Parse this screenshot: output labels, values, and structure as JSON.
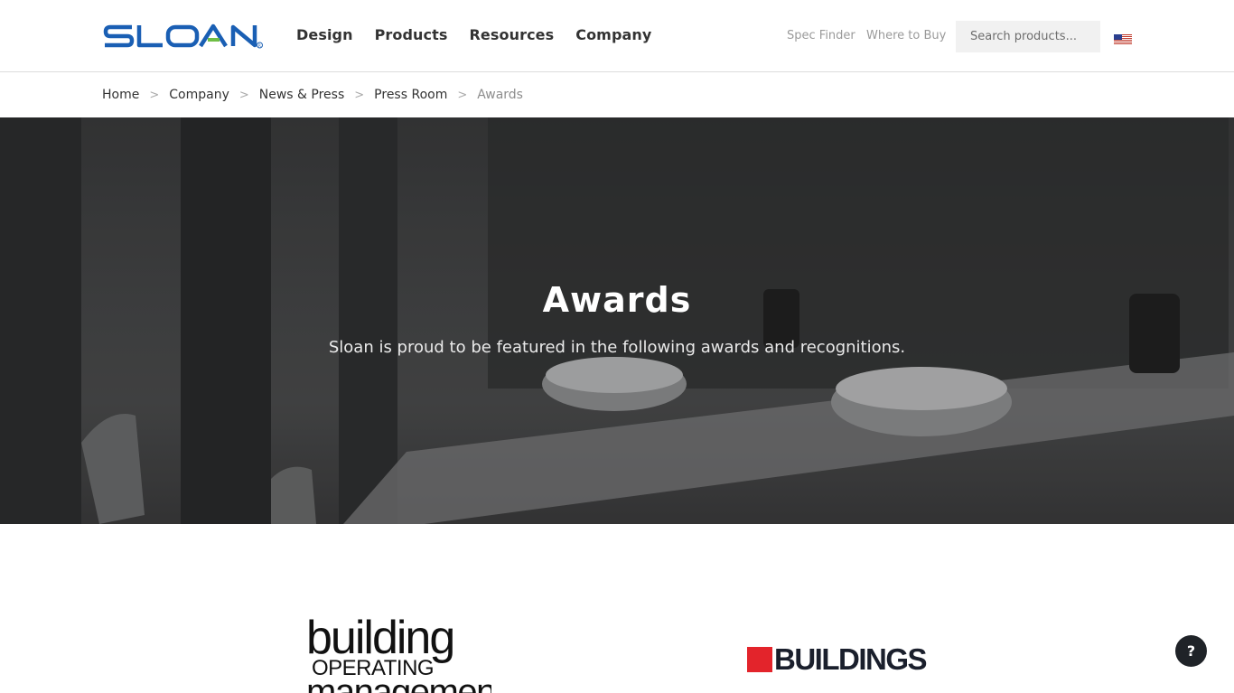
{
  "header": {
    "logo_text": "SLOAN",
    "nav": [
      "Design",
      "Products",
      "Resources",
      "Company"
    ],
    "spec_finder": "Spec Finder",
    "where_to_buy": "Where to Buy",
    "search_placeholder": "Search products...",
    "locale_icon": "us-flag-icon"
  },
  "breadcrumb": [
    "Home",
    "Company",
    "News & Press",
    "Press Room",
    "Awards"
  ],
  "breadcrumb_separator": ">",
  "hero": {
    "title": "Awards",
    "subtitle": "Sloan is proud to be featured in the following awards and recognitions."
  },
  "awards": {
    "bom": {
      "line1": "building",
      "line2": "OPERATING",
      "line3": "management"
    },
    "buildings": {
      "text": "BUILDINGS"
    }
  },
  "help": {
    "label": "?"
  },
  "colors": {
    "brand_blue": "#1a5fb4",
    "brand_green": "#6fbe44",
    "buildings_red": "#e3242b",
    "dark": "#1f2328"
  }
}
